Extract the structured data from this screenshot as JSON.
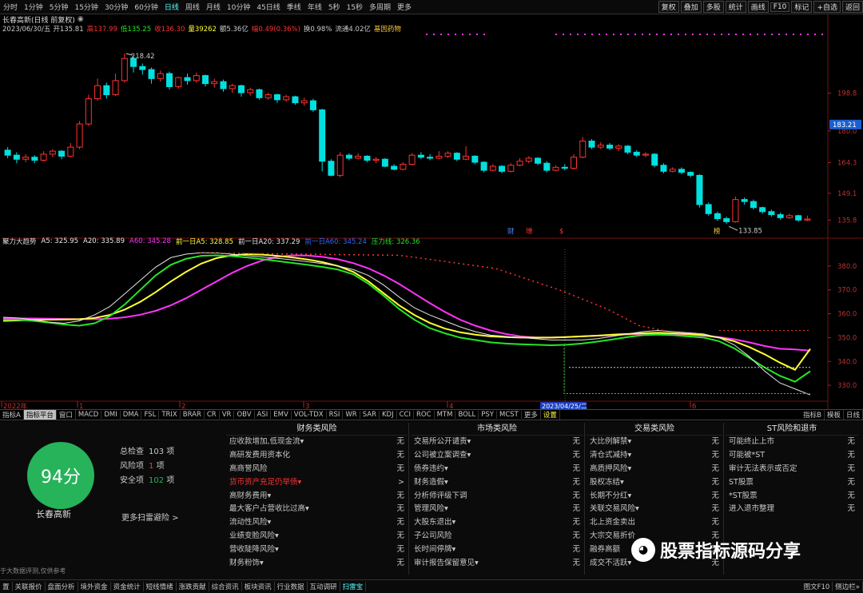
{
  "period_bar": {
    "items": [
      "分时",
      "1分钟",
      "5分钟",
      "15分钟",
      "30分钟",
      "60分钟",
      "日线",
      "周线",
      "月线",
      "10分钟",
      "45日线",
      "季线",
      "年线",
      "5秒",
      "15秒",
      "多周期",
      "更多"
    ],
    "active": "日线",
    "right": [
      "复权",
      "叠加",
      "多股",
      "统计",
      "画线",
      "F10",
      "标记",
      "+自选",
      "返回"
    ]
  },
  "stock": {
    "title": "长春高新(日线 前复权)",
    "date": "2023/06/30/五",
    "open_label": "开135.81",
    "high_label": "高137.99",
    "low_label": "低135.25",
    "close_label": "收136.30",
    "vol_label": "量39262",
    "amount_label": "额5.36亿",
    "change_label": "幅0.49(0.36%)",
    "turnover_label": "换0.98%",
    "float_label": "流通4.02亿",
    "sector": "基因药物",
    "current_price": "183.21"
  },
  "price_axis": [
    "198.8",
    "180.0",
    "164.3",
    "149.1",
    "135.8"
  ],
  "price_marks": {
    "high_label": "218.42",
    "low_label": "133.85",
    "events": [
      "财",
      "增",
      "$",
      "榜"
    ]
  },
  "indicator": {
    "name": "聚力大趋势",
    "a5": "A5: 325.95",
    "a20": "A20: 335.89",
    "a60": "A60: 345.28",
    "qianyiri_a5": "前一日A5: 328.85",
    "qianyiri_a20": "前一日A20: 337.29",
    "qianyiri_a60": "前一日A60: 345.24",
    "yali": "压力线: 326.36",
    "axis": [
      "380.0",
      "370.0",
      "360.0",
      "350.0",
      "340.0",
      "330.0"
    ]
  },
  "x_axis": {
    "labels": [
      "2022年",
      "1",
      "2",
      "3",
      "4",
      "6"
    ],
    "highlight": "2023/04/25/二"
  },
  "tabs": [
    "指标A",
    "指标平台",
    "窗口",
    "MACD",
    "DMI",
    "DMA",
    "FSL",
    "TRIX",
    "BRAR",
    "CR",
    "VR",
    "OBV",
    "ASI",
    "EMV",
    "VOL-TDX",
    "RSI",
    "WR",
    "SAR",
    "KDJ",
    "CCI",
    "ROC",
    "MTM",
    "BOLL",
    "PSY",
    "MCST",
    "更多",
    "设置"
  ],
  "tabs_active": "指标平台",
  "tabs_right": [
    "指标B",
    "模板",
    "日线"
  ],
  "risk": {
    "score": "94分",
    "stock_name": "长春高新",
    "total_label": "总检查",
    "total": "103",
    "total_unit": "项",
    "risk_label": "风险项",
    "risk": "1",
    "risk_unit": "项",
    "safe_label": "安全项",
    "safe": "102",
    "safe_unit": "项",
    "more": "更多扫雷避险 >",
    "disclaimer": "于大数据评测,仅供参考",
    "columns": [
      {
        "title": "财务类风险",
        "items": [
          [
            "应收款增加,低现金流▾",
            "无"
          ],
          [
            "高研发费用资本化",
            "无"
          ],
          [
            "高商誉风险",
            "无"
          ],
          [
            "货币资产充足仍举债▾",
            ">"
          ],
          [
            "高财务费用▾",
            "无"
          ],
          [
            "最大客户占营收比过高▾",
            "无"
          ],
          [
            "流动性风险▾",
            "无"
          ],
          [
            "业绩变脸风险▾",
            "无"
          ],
          [
            "营收陡降风险▾",
            "无"
          ],
          [
            "财务粉饰▾",
            "无"
          ]
        ]
      },
      {
        "title": "市场类风险",
        "items": [
          [
            "交易所公开谴责▾",
            "无"
          ],
          [
            "公司被立案调查▾",
            "无"
          ],
          [
            "债券违约▾",
            "无"
          ],
          [
            "财务造假▾",
            "无"
          ],
          [
            "分析师评级下调",
            "无"
          ],
          [
            "管理风险▾",
            "无"
          ],
          [
            "大股东退出▾",
            "无"
          ],
          [
            "子公司风险",
            "无"
          ],
          [
            "长时间停牌▾",
            "无"
          ],
          [
            "审计报告保留意见▾",
            "无"
          ]
        ]
      },
      {
        "title": "交易类风险",
        "items": [
          [
            "大比例解禁▾",
            "无"
          ],
          [
            "清仓式减持▾",
            "无"
          ],
          [
            "高质押风险▾",
            "无"
          ],
          [
            "股权冻结▾",
            "无"
          ],
          [
            "长期不分红▾",
            "无"
          ],
          [
            "关联交易风险▾",
            "无"
          ],
          [
            "北上资金卖出",
            "无"
          ],
          [
            "大宗交易折价",
            "无"
          ],
          [
            "融券高额",
            "无"
          ],
          [
            "成交不活跃▾",
            "无"
          ]
        ]
      },
      {
        "title": "ST风险和退市",
        "items": [
          [
            "可能终止上市",
            "无"
          ],
          [
            "可能被*ST",
            "无"
          ],
          [
            "审计无法表示或否定",
            "无"
          ],
          [
            "ST股票",
            "无"
          ],
          [
            "*ST股票",
            "无"
          ],
          [
            "进入退市整理",
            "无"
          ]
        ]
      }
    ]
  },
  "watermark": "股票指标源码分享",
  "bottom_bar": {
    "items": [
      "置",
      "关联报价",
      "盘面分析",
      "境外资金",
      "资金统计",
      "短线情绪",
      "涨跌贡献",
      "综合资讯",
      "板块资讯",
      "行业数据",
      "互动调研",
      "扫雷宝"
    ],
    "active": "扫雷宝",
    "right": [
      "图文F10",
      "侧边栏»"
    ]
  },
  "colors": {
    "up": "#ff3232",
    "down": "#00e0e0",
    "a5": "#e6e6e6",
    "a20": "#23e623",
    "a60": "#ffff33",
    "a120": "#ff33ff",
    "pressure": "#ff3333",
    "risk_green": "#27b35a"
  },
  "chart_data": {
    "type": "line",
    "candles": [
      [
        170.5,
        168.0,
        172.0,
        166.5
      ],
      [
        168.0,
        166.0,
        169.5,
        164.0
      ],
      [
        166.0,
        167.0,
        168.5,
        164.5
      ],
      [
        167.0,
        165.5,
        168.0,
        164.0
      ],
      [
        165.5,
        168.5,
        170.0,
        165.0
      ],
      [
        168.5,
        170.0,
        171.0,
        167.0
      ],
      [
        170.0,
        167.5,
        170.5,
        166.0
      ],
      [
        167.5,
        172.0,
        174.0,
        167.0
      ],
      [
        172.0,
        183.5,
        185.0,
        171.0
      ],
      [
        183.5,
        196.0,
        198.0,
        182.5
      ],
      [
        196.0,
        202.5,
        206.0,
        195.0
      ],
      [
        202.5,
        198.0,
        204.0,
        196.0
      ],
      [
        198.0,
        205.0,
        208.5,
        197.5
      ],
      [
        205.0,
        216.0,
        218.42,
        204.0
      ],
      [
        216.0,
        212.0,
        217.0,
        209.0
      ],
      [
        212.0,
        210.5,
        213.5,
        208.0
      ],
      [
        210.5,
        206.0,
        211.5,
        203.5
      ],
      [
        206.0,
        208.5,
        210.0,
        204.5
      ],
      [
        208.5,
        202.0,
        209.5,
        200.5
      ],
      [
        202.0,
        206.5,
        207.0,
        201.0
      ],
      [
        206.5,
        205.0,
        208.5,
        203.0
      ],
      [
        205.0,
        207.5,
        209.0,
        204.0
      ],
      [
        207.5,
        203.5,
        208.0,
        202.0
      ],
      [
        203.5,
        204.5,
        206.0,
        201.5
      ],
      [
        204.5,
        201.0,
        205.5,
        199.5
      ],
      [
        201.0,
        202.5,
        203.5,
        199.0
      ],
      [
        202.5,
        199.0,
        203.0,
        197.0
      ],
      [
        199.0,
        200.5,
        201.5,
        197.5
      ],
      [
        200.5,
        196.5,
        201.0,
        195.5
      ],
      [
        196.5,
        198.0,
        199.0,
        195.5
      ],
      [
        198.0,
        195.5,
        198.5,
        194.0
      ],
      [
        195.5,
        197.0,
        198.0,
        194.5
      ],
      [
        197.0,
        194.0,
        197.5,
        193.0
      ],
      [
        194.0,
        195.0,
        196.5,
        192.5
      ],
      [
        195.0,
        190.5,
        196.0,
        189.5
      ],
      [
        190.5,
        165.0,
        191.0,
        160.0
      ],
      [
        165.0,
        158.0,
        166.0,
        157.5
      ],
      [
        158.0,
        168.0,
        169.5,
        157.0
      ],
      [
        168.0,
        166.5,
        169.0,
        165.5
      ],
      [
        166.5,
        167.5,
        169.0,
        166.0
      ],
      [
        167.5,
        165.5,
        168.0,
        164.5
      ],
      [
        165.5,
        166.0,
        167.0,
        164.0
      ],
      [
        166.0,
        162.5,
        166.5,
        162.0
      ],
      [
        162.5,
        161.0,
        163.5,
        160.5
      ],
      [
        161.0,
        163.5,
        164.5,
        160.5
      ],
      [
        163.5,
        168.0,
        169.0,
        163.0
      ],
      [
        168.0,
        167.0,
        169.5,
        166.0
      ],
      [
        167.0,
        166.5,
        168.5,
        165.5
      ],
      [
        166.5,
        167.5,
        170.0,
        166.0
      ],
      [
        167.5,
        169.0,
        170.0,
        166.5
      ],
      [
        169.0,
        166.0,
        169.5,
        165.0
      ],
      [
        166.0,
        167.5,
        172.5,
        165.5
      ],
      [
        167.5,
        164.5,
        168.0,
        163.5
      ],
      [
        164.5,
        160.5,
        165.0,
        159.5
      ],
      [
        160.5,
        162.5,
        163.5,
        160.0
      ],
      [
        162.5,
        160.0,
        163.0,
        159.0
      ],
      [
        160.0,
        163.0,
        164.0,
        159.5
      ],
      [
        163.0,
        165.0,
        166.5,
        162.5
      ],
      [
        165.0,
        166.5,
        167.5,
        164.0
      ],
      [
        166.5,
        164.0,
        167.0,
        163.0
      ],
      [
        164.0,
        160.5,
        165.0,
        159.5
      ],
      [
        160.5,
        162.0,
        163.0,
        160.0
      ],
      [
        162.0,
        161.5,
        163.5,
        160.5
      ],
      [
        161.5,
        167.0,
        168.5,
        161.0
      ],
      [
        167.0,
        175.0,
        177.0,
        166.5
      ],
      [
        175.0,
        172.0,
        176.0,
        171.0
      ],
      [
        172.0,
        173.0,
        174.5,
        171.0
      ],
      [
        173.0,
        171.5,
        174.0,
        170.5
      ],
      [
        171.5,
        172.5,
        173.5,
        170.0
      ],
      [
        172.5,
        169.5,
        173.0,
        168.5
      ],
      [
        169.5,
        168.0,
        170.5,
        167.0
      ],
      [
        168.0,
        168.5,
        169.5,
        167.0
      ],
      [
        168.5,
        163.0,
        169.0,
        162.0
      ],
      [
        163.0,
        160.0,
        164.0,
        159.0
      ],
      [
        160.0,
        161.0,
        162.0,
        159.5
      ],
      [
        161.0,
        159.5,
        162.0,
        158.5
      ],
      [
        159.5,
        158.0,
        160.0,
        157.0
      ],
      [
        158.0,
        143.5,
        158.5,
        142.0
      ],
      [
        143.5,
        139.0,
        144.5,
        138.0
      ],
      [
        139.0,
        136.5,
        140.0,
        135.5
      ],
      [
        136.5,
        135.0,
        137.5,
        133.85
      ],
      [
        135.0,
        146.0,
        147.5,
        134.5
      ],
      [
        146.0,
        145.0,
        147.0,
        143.5
      ],
      [
        145.0,
        142.0,
        146.0,
        141.0
      ],
      [
        142.0,
        140.0,
        142.5,
        139.0
      ],
      [
        140.0,
        138.5,
        141.0,
        137.5
      ],
      [
        138.5,
        137.0,
        139.5,
        136.0
      ],
      [
        137.0,
        138.0,
        139.0,
        136.5
      ],
      [
        138.0,
        135.81,
        138.5,
        135.0
      ],
      [
        135.81,
        136.3,
        137.99,
        135.25
      ]
    ],
    "indicator_series": {
      "A5": [
        358.5,
        358.2,
        357.4,
        356.5,
        356.0,
        357.0,
        359.5,
        363.0,
        368.5,
        374.0,
        379.5,
        383.5,
        385.0,
        385.6,
        385.5,
        385.0,
        384.4,
        383.8,
        383.2,
        382.6,
        381.8,
        381.0,
        380.0,
        378.5,
        376.0,
        372.0,
        367.0,
        362.5,
        359.5,
        357.0,
        354.5,
        352.5,
        351.0,
        350.5,
        350.0,
        349.5,
        349.0,
        349.0,
        349.0,
        349.5,
        350.5,
        351.5,
        352.5,
        353.0,
        352.5,
        352.0,
        351.5,
        350.0,
        347.0,
        342.0,
        336.0,
        331.0,
        328.5,
        325.95
      ],
      "A20": [
        357.5,
        357.5,
        357.0,
        356.3,
        355.5,
        355.0,
        356.0,
        359.0,
        364.0,
        370.0,
        376.0,
        380.5,
        383.0,
        384.3,
        384.5,
        384.2,
        383.6,
        382.9,
        382.1,
        381.3,
        380.5,
        379.6,
        378.5,
        376.5,
        372.5,
        367.5,
        362.0,
        357.5,
        354.0,
        351.8,
        350.0,
        349.0,
        348.0,
        347.5,
        347.2,
        347.0,
        346.8,
        347.0,
        347.5,
        348.3,
        349.2,
        350.2,
        351.0,
        351.2,
        351.0,
        350.5,
        350.0,
        348.5,
        345.5,
        341.5,
        337.5,
        334.0,
        331.5,
        335.89
      ],
      "A60": [
        357.0,
        357.2,
        357.4,
        357.5,
        357.6,
        357.7,
        358.2,
        359.5,
        361.8,
        365.0,
        369.0,
        373.5,
        377.5,
        381.0,
        383.3,
        384.5,
        385.0,
        384.8,
        384.3,
        383.6,
        382.7,
        381.6,
        380.0,
        377.5,
        373.5,
        368.5,
        363.5,
        359.5,
        356.2,
        353.8,
        352.2,
        351.2,
        350.5,
        350.2,
        350.0,
        350.0,
        350.0,
        350.2,
        350.5,
        350.8,
        351.2,
        351.5,
        351.8,
        352.0,
        351.8,
        351.5,
        351.0,
        350.0,
        348.5,
        346.0,
        343.0,
        339.5,
        336.5,
        345.28
      ],
      "A120": [
        358.0,
        358.0,
        358.0,
        357.9,
        357.8,
        357.7,
        357.7,
        357.9,
        358.5,
        359.6,
        361.2,
        363.5,
        366.5,
        370.0,
        373.5,
        377.0,
        380.0,
        382.3,
        383.8,
        384.5,
        384.4,
        383.8,
        382.8,
        381.2,
        379.0,
        376.0,
        372.5,
        368.5,
        364.5,
        360.8,
        357.5,
        355.0,
        353.0,
        351.5,
        350.5,
        350.0,
        350.0,
        350.2,
        350.5,
        350.8,
        351.0,
        351.3,
        351.5,
        351.6,
        351.5,
        351.2,
        350.8,
        350.2,
        349.3,
        348.0,
        346.5,
        345.3,
        345.0,
        344.5
      ]
    }
  }
}
